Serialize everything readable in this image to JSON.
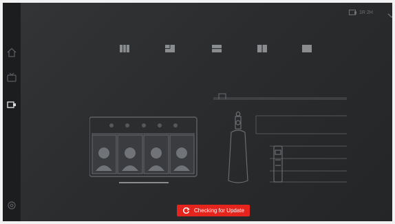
{
  "sidebar": {
    "items": [
      {
        "icon": "home-icon"
      },
      {
        "icon": "tv-icon"
      },
      {
        "icon": "display-input-icon",
        "active": true
      },
      {
        "icon": "settings-icon"
      }
    ]
  },
  "topbar": {
    "status_icon": "display-icon",
    "status_text": "1R 2H",
    "menu_icon": "chevron-down-icon"
  },
  "mode_tabs": [
    {
      "icon": "layout-grid-icon"
    },
    {
      "icon": "layout-split-icon"
    },
    {
      "icon": "layout-stack-icon"
    },
    {
      "icon": "layout-columns-icon"
    },
    {
      "icon": "layout-full-icon"
    }
  ],
  "status": {
    "icon": "refresh-icon",
    "label": "Checking for Update",
    "color": "#e5251d"
  }
}
